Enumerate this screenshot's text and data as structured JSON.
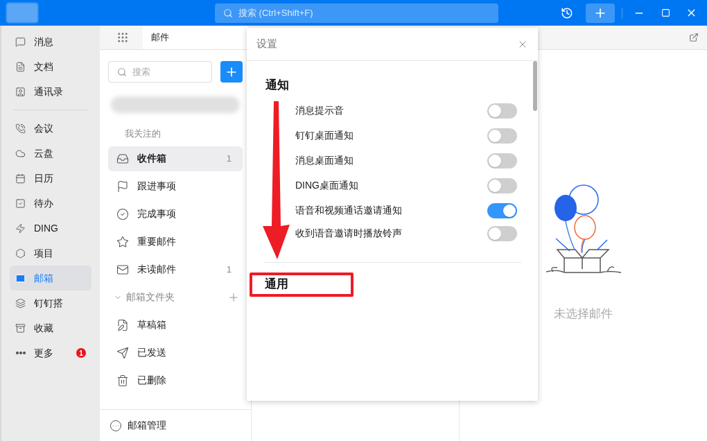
{
  "title_bar": {
    "search_placeholder": "搜索 (Ctrl+Shift+F)"
  },
  "sidebar": {
    "top_items": [
      {
        "label": "消息",
        "selected": false
      },
      {
        "label": "文档",
        "selected": false
      },
      {
        "label": "通讯录",
        "selected": false
      }
    ],
    "items": [
      {
        "label": "会议",
        "selected": false
      },
      {
        "label": "云盘",
        "selected": false
      },
      {
        "label": "日历",
        "selected": false
      },
      {
        "label": "待办",
        "selected": false
      },
      {
        "label": "DING",
        "selected": false
      },
      {
        "label": "项目",
        "selected": false
      },
      {
        "label": "邮箱",
        "selected": true
      },
      {
        "label": "钉钉搭",
        "selected": false
      },
      {
        "label": "收藏",
        "selected": false
      },
      {
        "label": "更多",
        "selected": false,
        "badge": "1"
      }
    ]
  },
  "tabs": [
    {
      "label": "邮件",
      "selected": true
    }
  ],
  "mail_nav": {
    "search_placeholder": "搜索",
    "section_title": "我关注的",
    "items": [
      {
        "label": "收件箱",
        "count": "1",
        "selected": true
      },
      {
        "label": "跟进事项",
        "selected": false
      },
      {
        "label": "完成事项",
        "selected": false
      },
      {
        "label": "重要邮件",
        "selected": false
      },
      {
        "label": "未读邮件",
        "count": "1",
        "selected": false
      }
    ],
    "folder_header": {
      "label": "邮箱文件夹",
      "expanded": true
    },
    "folders": [
      {
        "label": "草稿箱",
        "selected": false
      },
      {
        "label": "已发送",
        "selected": false
      },
      {
        "label": "已删除",
        "selected": false
      }
    ],
    "footer": "邮箱管理"
  },
  "empty_state": {
    "text": "未选择邮件"
  },
  "settings": {
    "title": "设置",
    "arrow": true,
    "sections": [
      {
        "heading": "通知",
        "highlighted": false,
        "rows": [
          {
            "label": "消息提示音",
            "on": false
          },
          {
            "label": "钉钉桌面通知",
            "on": false
          },
          {
            "label": "消息桌面通知",
            "on": false
          },
          {
            "label": "DING桌面通知",
            "on": false
          },
          {
            "label": "语音和视频通话邀请通知",
            "on": true
          },
          {
            "label": "收到语音邀请时播放铃声",
            "on": false
          }
        ]
      },
      {
        "heading": "通用",
        "highlighted": true
      }
    ]
  }
}
